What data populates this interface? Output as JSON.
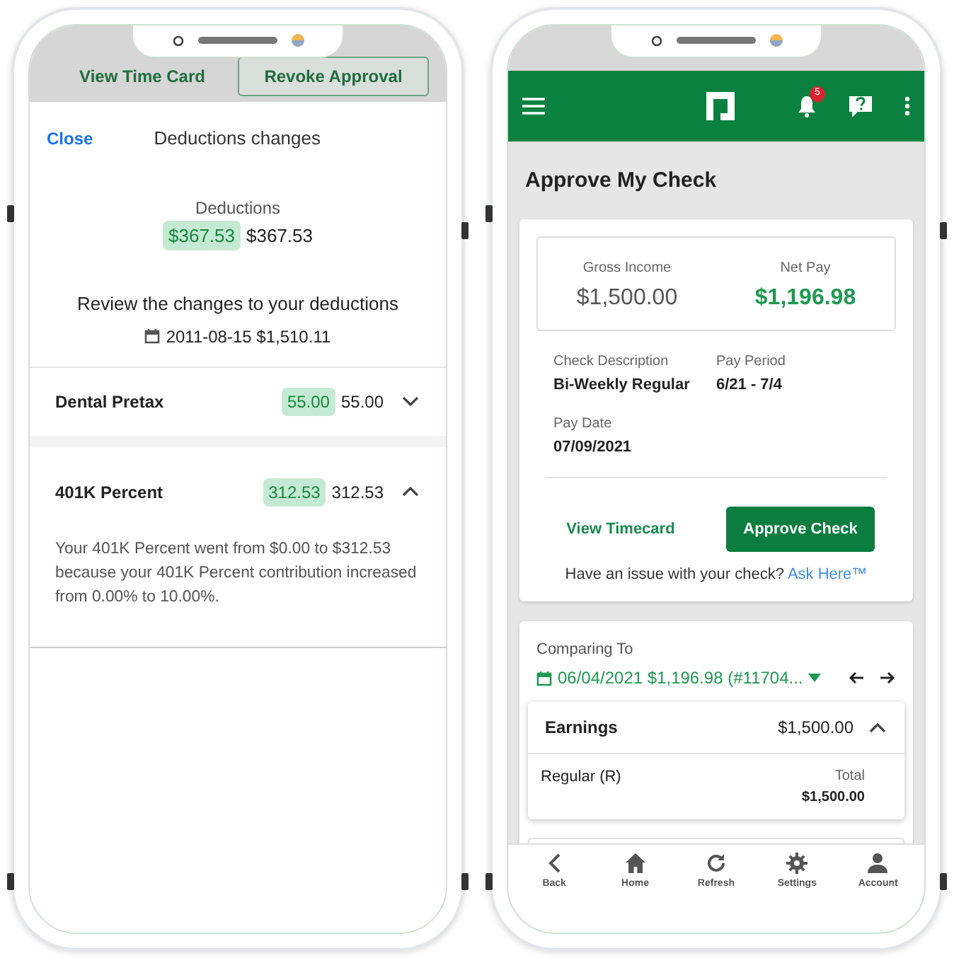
{
  "left_phone": {
    "tabs": [
      {
        "label": "View Time Card",
        "selected": false
      },
      {
        "label": "Revoke Approval",
        "selected": true
      }
    ],
    "sheet": {
      "close": "Close",
      "title": "Deductions changes",
      "summary_label": "Deductions",
      "summary_new": "$367.53",
      "summary_old": "$367.53",
      "review_heading": "Review the changes to your deductions",
      "review_date": "2011-08-15 $1,510.11",
      "items": [
        {
          "name": "Dental Pretax",
          "new": "55.00",
          "old": "55.00",
          "expanded": false
        },
        {
          "name": "401K Percent",
          "new": "312.53",
          "old": "312.53",
          "expanded": true,
          "detail": "Your 401K Percent went from $0.00 to $312.53 because your 401K Percent contribution increased from 0.00% to 10.00%."
        }
      ]
    }
  },
  "right_phone": {
    "notification_count": "5",
    "page_title": "Approve My Check",
    "summary": [
      {
        "label": "Gross Income",
        "value": "$1,500.00",
        "kind": "plain"
      },
      {
        "label": "Net Pay",
        "value": "$1,196.98",
        "kind": "highlight"
      }
    ],
    "details": [
      {
        "label": "Check Description",
        "value": "Bi-Weekly Regular"
      },
      {
        "label": "Pay Period",
        "value": "6/21 - 7/4"
      },
      {
        "label": "Pay Date",
        "value": "07/09/2021"
      }
    ],
    "view_timecard": "View Timecard",
    "approve": "Approve Check",
    "issue_text": "Have an issue with your check?",
    "ask_link": "Ask Here™",
    "comparing_label": "Comparing To",
    "comparing_value": "06/04/2021 $1,196.98 (#11704...",
    "earnings": {
      "title": "Earnings",
      "amount": "$1,500.00",
      "expanded": true,
      "rows": [
        {
          "name": "Regular (R)",
          "total_label": "Total",
          "total": "$1,500.00"
        }
      ]
    },
    "nav": [
      {
        "label": "Back",
        "kind": "back"
      },
      {
        "label": "Home",
        "kind": "home"
      },
      {
        "label": "Refresh",
        "kind": "refresh"
      },
      {
        "label": "Settings",
        "kind": "settings"
      },
      {
        "label": "Account",
        "kind": "account"
      }
    ]
  }
}
